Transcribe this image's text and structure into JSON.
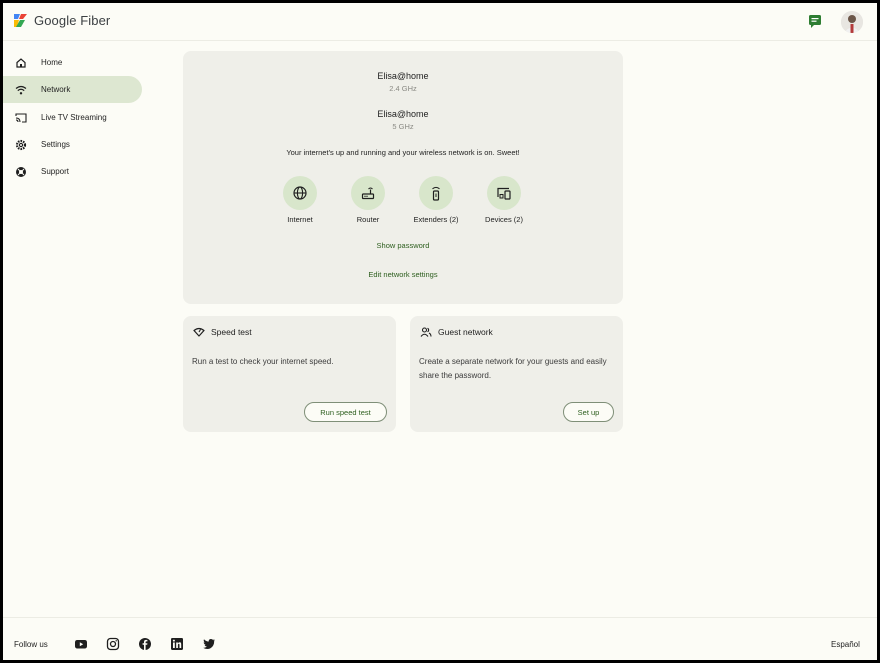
{
  "brand": {
    "name": "Google Fiber",
    "logo": "google-fiber-logo"
  },
  "header": {
    "chat_icon": "chat-icon",
    "avatar": "user-avatar"
  },
  "sidebar": {
    "items": [
      {
        "label": "Home",
        "icon": "home-icon"
      },
      {
        "label": "Network",
        "icon": "wifi-icon",
        "active": true
      },
      {
        "label": "Live TV Streaming",
        "icon": "cast-icon"
      },
      {
        "label": "Settings",
        "icon": "gear-icon"
      },
      {
        "label": "Support",
        "icon": "support-icon"
      }
    ]
  },
  "network": {
    "networks": [
      {
        "ssid": "Elisa@home",
        "band": "2.4 GHz"
      },
      {
        "ssid": "Elisa@home",
        "band": "5 GHz"
      }
    ],
    "status": "Your internet's up and running and your wireless network is on. Sweet!",
    "items": [
      {
        "label": "Internet",
        "icon": "globe-icon"
      },
      {
        "label": "Router",
        "icon": "router-icon"
      },
      {
        "label": "Extenders (2)",
        "icon": "extender-icon"
      },
      {
        "label": "Devices (2)",
        "icon": "devices-icon"
      }
    ],
    "show_password": "Show password",
    "edit_settings": "Edit network settings"
  },
  "speed_test": {
    "title": "Speed test",
    "body": "Run a test to check your internet speed.",
    "button": "Run speed test"
  },
  "guest_network": {
    "title": "Guest network",
    "body": "Create a separate network for your guests and easily share the password.",
    "button": "Set up"
  },
  "footer": {
    "follow": "Follow us",
    "social": [
      "youtube-icon",
      "instagram-icon",
      "facebook-icon",
      "linkedin-icon",
      "twitter-icon"
    ],
    "language": "Español"
  },
  "colors": {
    "background": "#fcfcf6",
    "card": "#efefe9",
    "active_nav": "#dde7d1",
    "icon_circle": "#d8e6cb",
    "link_green": "#2d5e1e"
  }
}
